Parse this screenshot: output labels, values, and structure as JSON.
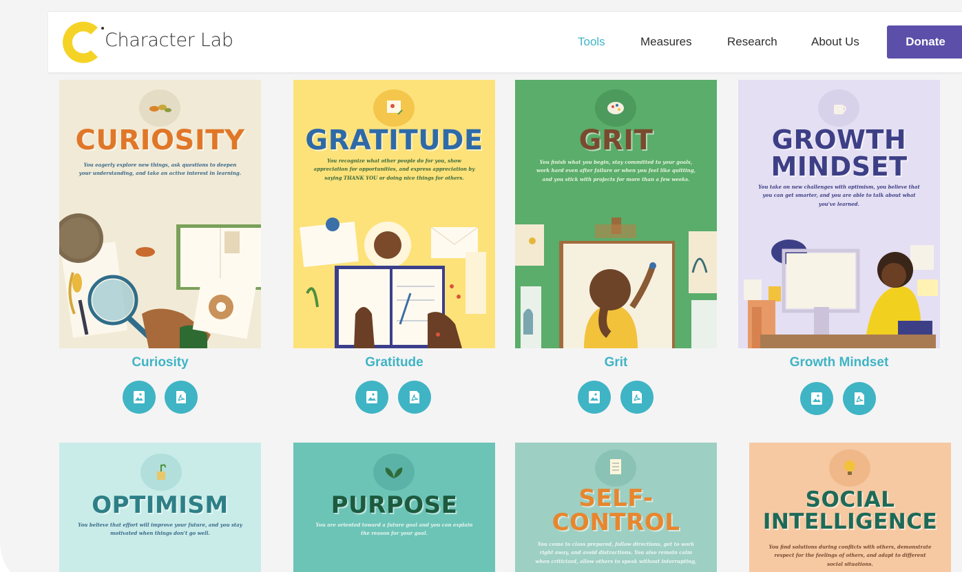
{
  "header": {
    "brand": "Character Lab",
    "nav": [
      "Tools",
      "Measures",
      "Research",
      "About Us"
    ],
    "donate": "Donate"
  },
  "colors": {
    "accent": "#3fb4c4",
    "donate": "#5b4fa9",
    "brand_yellow": "#f5d326"
  },
  "cards": [
    {
      "topic": "CURIOSITY",
      "title": "Curiosity",
      "desc": "You eagerly explore new things, ask questions to deepen your understanding, and take an active interest in learning."
    },
    {
      "topic": "GRATITUDE",
      "title": "Gratitude",
      "desc": "You recognize what other people do for you, show appreciation for opportunities, and express appreciation by saying THANK YOU or doing nice things for others."
    },
    {
      "topic": "GRIT",
      "title": "Grit",
      "desc": "You finish what you begin, stay committed to your goals, work hard even after failure or when you feel like quitting, and you stick with projects for more than a few weeks."
    },
    {
      "topic": "GROWTH MINDSET",
      "title": "Growth Mindset",
      "desc": "You take on new challenges with optimism, you believe that you can get smarter, and you are able to talk about what you've learned."
    },
    {
      "topic": "OPTIMISM",
      "desc": "You believe that effort will improve your future, and you stay motivated when things don't go well."
    },
    {
      "topic": "PURPOSE",
      "desc": "You are oriented toward a future goal and you can explain the reason for your goal."
    },
    {
      "topic": "SELF-CONTROL",
      "desc": "You come to class prepared, follow directions, get to work right away, and avoid distractions. You also remain calm when criticized, allow others to speak without interrupting,"
    },
    {
      "topic": "SOCIAL INTELLIGENCE",
      "desc": "You find solutions during conflicts with others, demonstrate respect for the feelings of others, and adapt to different social situations."
    }
  ],
  "icons": {
    "image": "image-download-icon",
    "pdf": "pdf-download-icon"
  }
}
